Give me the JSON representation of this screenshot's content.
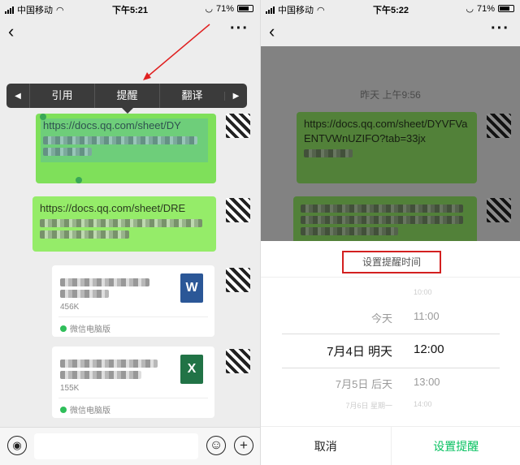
{
  "left": {
    "status": {
      "carrier": "中国移动",
      "time": "下午5:21",
      "battery": "71%"
    },
    "nav": {
      "back_icon": "‹",
      "title": "",
      "more_icon": "···"
    },
    "context_menu": {
      "items": [
        "引用",
        "提醒",
        "翻译"
      ],
      "prev_icon": "◀",
      "next_icon": "▶"
    },
    "messages": [
      {
        "text": "https://docs.qq.com/sheet/DY"
      },
      {
        "text": "https://docs.qq.com/sheet/DRE"
      }
    ],
    "files": [
      {
        "size": "456K",
        "source": "微信电脑版",
        "icon": "W"
      },
      {
        "size": "155K",
        "source": "微信电脑版",
        "icon": "X"
      }
    ],
    "input": {
      "voice_icon": "◉",
      "emoji_icon": "☺",
      "plus_icon": "+"
    }
  },
  "right": {
    "status": {
      "carrier": "中国移动",
      "time": "下午5:22",
      "battery": "71%"
    },
    "nav": {
      "back_icon": "‹",
      "title": "",
      "more_icon": "···"
    },
    "timestamp": "昨天 上午9:56",
    "messages": [
      {
        "text": "https://docs.qq.com/sheet/DYVFVaENTVWnUZIFO?tab=33jx"
      }
    ],
    "sheet": {
      "title": "设置提醒时间",
      "rows": [
        {
          "date": "",
          "time": "10:00"
        },
        {
          "date": "今天",
          "time": "11:00"
        },
        {
          "date": "7月4日 明天",
          "time": "12:00"
        },
        {
          "date": "7月5日 后天",
          "time": "13:00"
        },
        {
          "date": "7月6日 星期一",
          "time": "14:00"
        }
      ],
      "cancel": "取消",
      "confirm": "设置提醒"
    }
  },
  "colors": {
    "bubble": "#95ec69",
    "accent": "#07c160",
    "highlight": "#d32020"
  }
}
